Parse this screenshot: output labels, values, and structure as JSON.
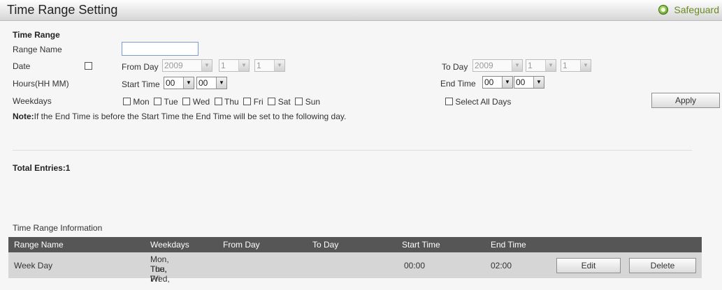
{
  "header": {
    "title": "Time Range Setting",
    "badge": "Safeguard"
  },
  "form": {
    "section_title": "Time Range",
    "range_name_label": "Range Name",
    "range_name_value": "",
    "date_label": "Date",
    "date_checked": false,
    "from_day_label": "From Day",
    "from_year": "2009",
    "from_month": "1",
    "from_day": "1",
    "to_day_label": "To Day",
    "to_year": "2009",
    "to_month": "1",
    "to_day": "1",
    "hours_label": "Hours(HH MM)",
    "start_time_label": "Start Time",
    "start_hour": "00",
    "start_min": "00",
    "end_time_label": "End Time",
    "end_hour": "00",
    "end_min": "00",
    "weekdays_label": "Weekdays",
    "days": [
      "Mon",
      "Tue",
      "Wed",
      "Thu",
      "Fri",
      "Sat",
      "Sun"
    ],
    "select_all_label": "Select All Days",
    "apply_label": "Apply",
    "note_prefix": "Note:",
    "note_text": "If the End Time is before the Start Time the End Time will be set to the following day."
  },
  "entries": {
    "total_label": "Total Entries:1"
  },
  "table": {
    "caption": "Time Range Information",
    "columns": [
      "Range Name",
      "Weekdays",
      "From Day",
      "To Day",
      "Start Time",
      "End Time"
    ],
    "rows": [
      {
        "range_name": "Week Day",
        "weekdays_line1": "Mon, Tue, Wed,",
        "weekdays_line2": "Thu, Fri",
        "from_day": "",
        "to_day": "",
        "start_time": "00:00",
        "end_time": "02:00",
        "edit_label": "Edit",
        "delete_label": "Delete"
      }
    ]
  },
  "colors": {
    "header_row": "#565656",
    "data_row": "#d6d6d6",
    "accent_green": "#6a8a25"
  }
}
